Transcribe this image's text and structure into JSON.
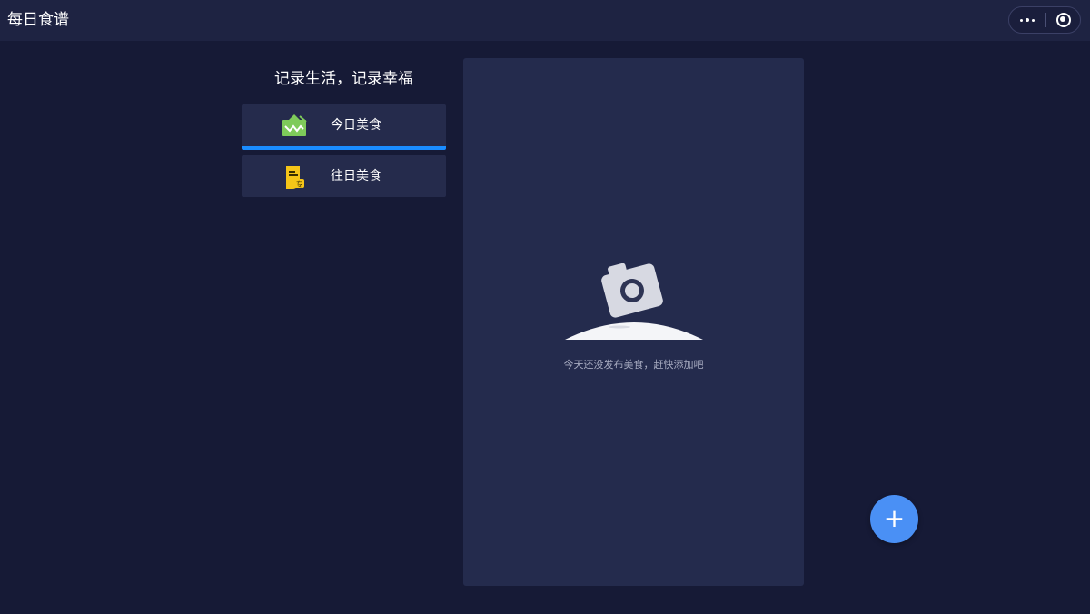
{
  "app": {
    "title": "每日食谱"
  },
  "capsule": {
    "more_icon": "more-dots-icon",
    "close_icon": "target-close-icon"
  },
  "sidebar": {
    "slogan": "记录生活，记录幸福",
    "items": [
      {
        "label": "今日美食",
        "icon": "today-food-icon",
        "active": true
      },
      {
        "label": "往日美食",
        "icon": "history-food-icon",
        "active": false
      }
    ]
  },
  "main": {
    "empty_text": "今天还没发布美食，赶快添加吧",
    "empty_icon": "camera-icon"
  },
  "fab": {
    "label": "+",
    "icon": "add-icon"
  },
  "colors": {
    "background": "#161a36",
    "titlebar": "#1e2342",
    "panel": "#242b4d",
    "nav_item": "#252b4c",
    "active_indicator": "#1a8cff",
    "fab": "#4a90f5"
  }
}
